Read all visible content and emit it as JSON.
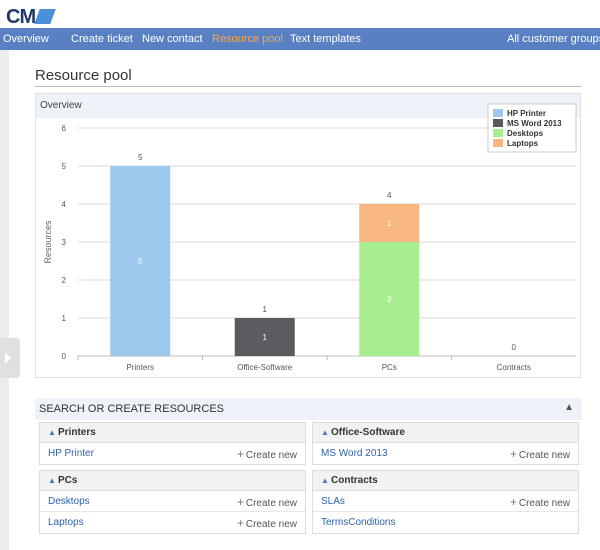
{
  "app": {
    "logo_text": "CM"
  },
  "nav": {
    "items": [
      {
        "label": "Overview"
      },
      {
        "label": "Create ticket"
      },
      {
        "label": "New contact"
      },
      {
        "label": "Resource pool",
        "active": true
      },
      {
        "label": "Text templates"
      }
    ],
    "right_label": "All customer groups"
  },
  "page": {
    "title": "Resource pool"
  },
  "chart_panel": {
    "header": "Overview"
  },
  "chart_data": {
    "type": "bar",
    "stacked": true,
    "categories": [
      "Printers",
      "Office-Software",
      "PCs",
      "Contracts"
    ],
    "series": [
      {
        "name": "HP Printer",
        "color": "#9ec9ee",
        "values": [
          5,
          0,
          0,
          0
        ]
      },
      {
        "name": "MS Word 2013",
        "color": "#5b5c60",
        "values": [
          0,
          1,
          0,
          0
        ]
      },
      {
        "name": "Desktops",
        "color": "#a8ee8f",
        "values": [
          0,
          0,
          3,
          0
        ]
      },
      {
        "name": "Laptops",
        "color": "#f8b781",
        "values": [
          0,
          0,
          1,
          0
        ]
      }
    ],
    "totals": [
      "5",
      "1",
      "4",
      "0"
    ],
    "ylabel": "Resources",
    "ylim": [
      0,
      6
    ],
    "yticks": [
      "0",
      "1",
      "2",
      "3",
      "4",
      "5",
      "6"
    ],
    "grid": true,
    "legend_position": "top-right"
  },
  "search": {
    "header": "SEARCH OR CREATE RESOURCES",
    "create_label": "Create new",
    "groups": [
      {
        "label": "Printers",
        "rows": [
          {
            "name": "HP Printer",
            "create": true
          }
        ]
      },
      {
        "label": "Office-Software",
        "rows": [
          {
            "name": "MS Word 2013",
            "create": true
          }
        ]
      },
      {
        "label": "PCs",
        "rows": [
          {
            "name": "Desktops",
            "create": true
          },
          {
            "name": "Laptops",
            "create": true
          }
        ]
      },
      {
        "label": "Contracts",
        "rows": [
          {
            "name": "SLAs",
            "create": true
          },
          {
            "name": "TermsConditions",
            "create": false
          }
        ]
      }
    ]
  }
}
